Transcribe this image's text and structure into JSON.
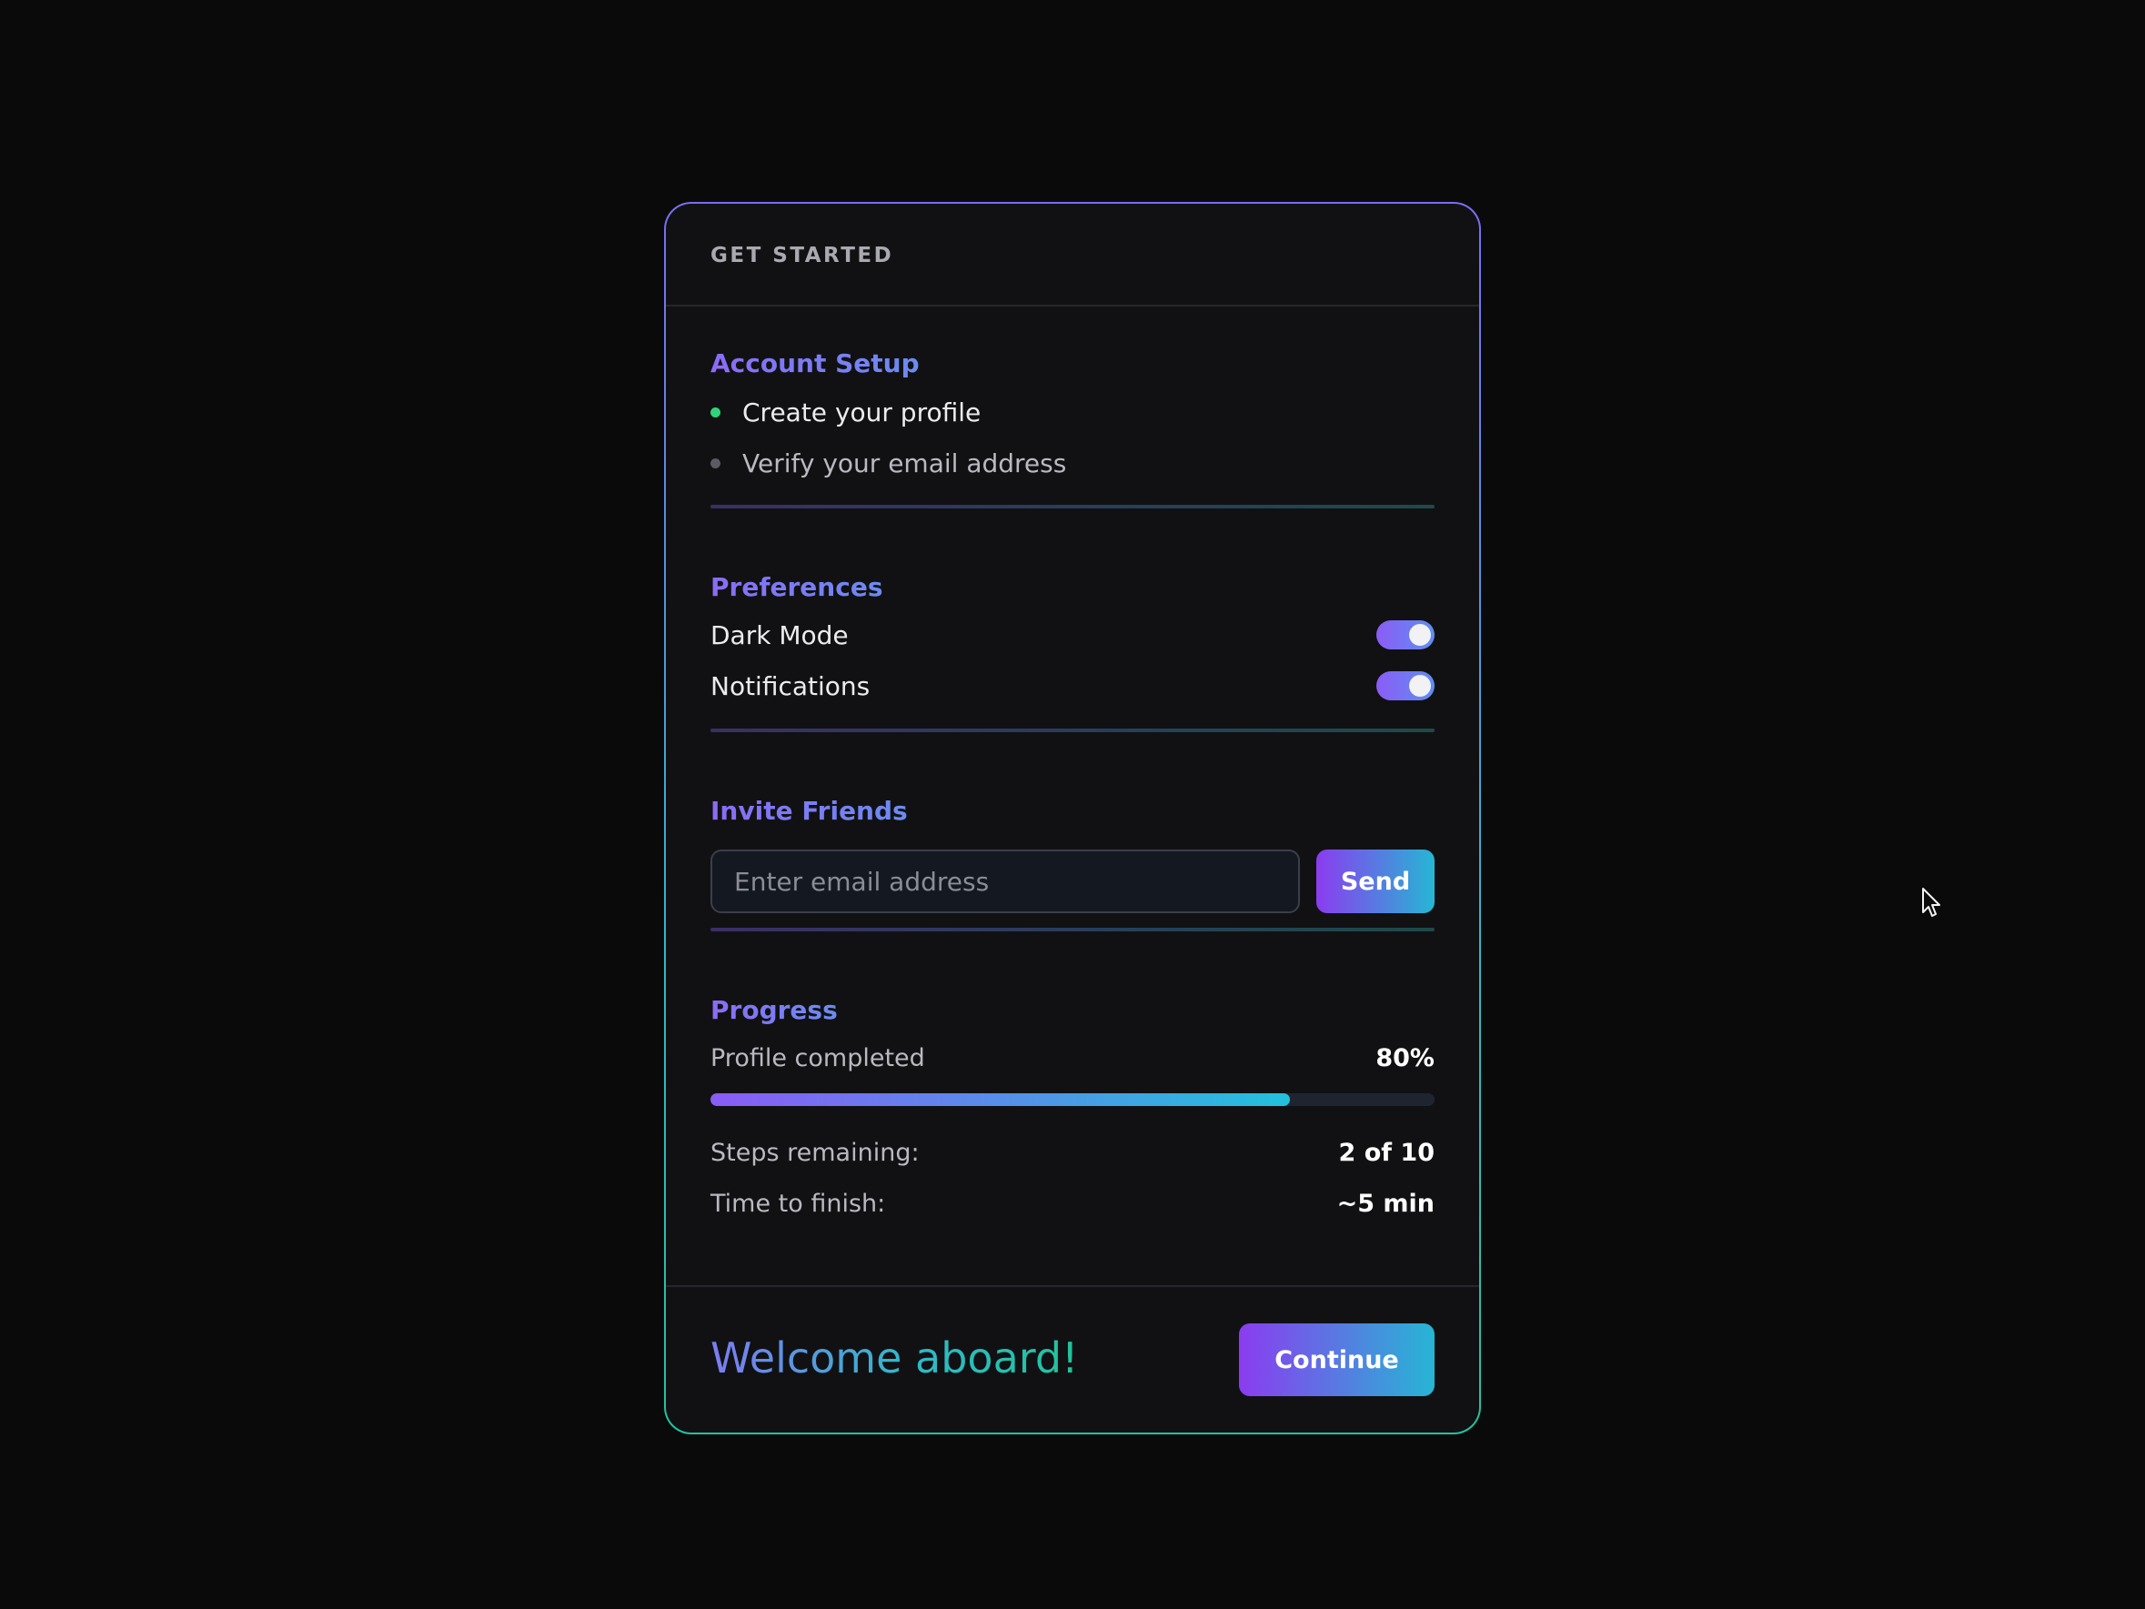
{
  "header": {
    "title": "GET STARTED"
  },
  "account_setup": {
    "title": "Account Setup",
    "items": [
      {
        "label": "Create your profile",
        "status": "done"
      },
      {
        "label": "Verify your email address",
        "status": "pending"
      }
    ]
  },
  "preferences": {
    "title": "Preferences",
    "items": [
      {
        "label": "Dark Mode",
        "enabled": true
      },
      {
        "label": "Notifications",
        "enabled": true
      }
    ]
  },
  "invite": {
    "title": "Invite Friends",
    "placeholder": "Enter email address",
    "value": "",
    "send_label": "Send"
  },
  "progress": {
    "title": "Progress",
    "profile_label": "Profile completed",
    "profile_value": "80%",
    "fraction": 0.8,
    "steps_label": "Steps remaining:",
    "steps_value": "2 of 10",
    "time_label": "Time to finish:",
    "time_value": "~5 min"
  },
  "footer": {
    "welcome": "Welcome aboard!",
    "continue_label": "Continue"
  },
  "colors": {
    "accent_purple": "#8b5cf6",
    "accent_cyan": "#22c1dc",
    "done_dot": "#2fd47a",
    "pending_dot": "#5b5b62",
    "background": "#0a0a0a",
    "card": "#111113"
  },
  "icons": {
    "cursor": "mouse-pointer-icon"
  }
}
